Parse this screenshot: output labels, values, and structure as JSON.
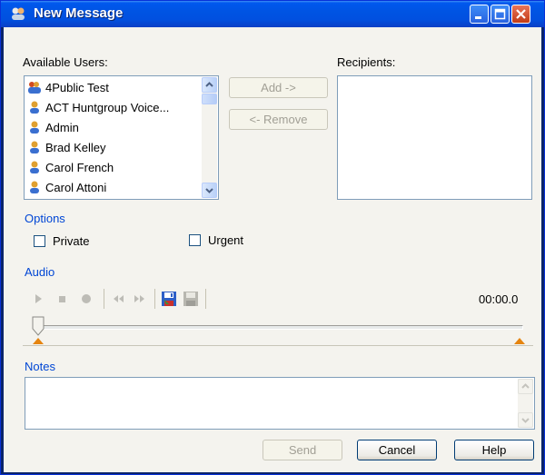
{
  "window": {
    "title": "New Message",
    "minimize_icon": "minimize-icon",
    "maximize_icon": "maximize-icon",
    "close_icon": "close-icon"
  },
  "users": {
    "label": "Available Users:",
    "items": [
      {
        "name": "4Public Test",
        "icon": "group-user-icon"
      },
      {
        "name": "ACT Huntgroup Voice...",
        "icon": "user-icon"
      },
      {
        "name": "Admin",
        "icon": "user-icon"
      },
      {
        "name": "Brad Kelley",
        "icon": "user-icon"
      },
      {
        "name": "Carol French",
        "icon": "user-icon"
      },
      {
        "name": "Carol Attoni",
        "icon": "user-icon"
      }
    ]
  },
  "actions": {
    "add_label": "Add ->",
    "remove_label": "<- Remove"
  },
  "recipients": {
    "label": "Recipients:"
  },
  "options": {
    "label": "Options",
    "private_label": "Private",
    "private_checked": false,
    "urgent_label": "Urgent",
    "urgent_checked": false
  },
  "audio": {
    "label": "Audio",
    "time": "00:00.0",
    "position": 0
  },
  "notes": {
    "label": "Notes",
    "value": ""
  },
  "footer": {
    "send_label": "Send",
    "cancel_label": "Cancel",
    "help_label": "Help"
  },
  "colors": {
    "title_bar": "#0054e3",
    "section_label": "#0046d5",
    "slider_marker": "#e5840f"
  }
}
